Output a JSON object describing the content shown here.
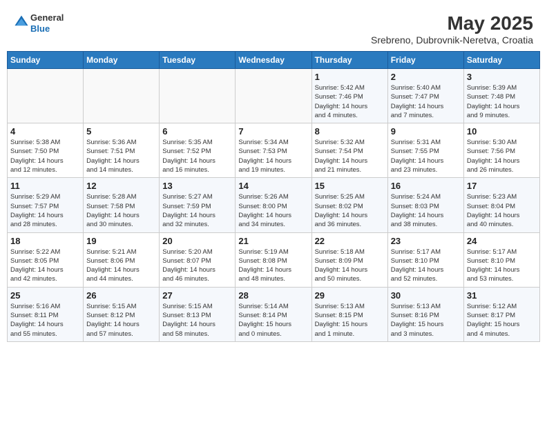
{
  "header": {
    "logo_general": "General",
    "logo_blue": "Blue",
    "month_year": "May 2025",
    "location": "Srebreno, Dubrovnik-Neretva, Croatia"
  },
  "days_of_week": [
    "Sunday",
    "Monday",
    "Tuesday",
    "Wednesday",
    "Thursday",
    "Friday",
    "Saturday"
  ],
  "weeks": [
    [
      {
        "day": "",
        "info": ""
      },
      {
        "day": "",
        "info": ""
      },
      {
        "day": "",
        "info": ""
      },
      {
        "day": "",
        "info": ""
      },
      {
        "day": "1",
        "info": "Sunrise: 5:42 AM\nSunset: 7:46 PM\nDaylight: 14 hours\nand 4 minutes."
      },
      {
        "day": "2",
        "info": "Sunrise: 5:40 AM\nSunset: 7:47 PM\nDaylight: 14 hours\nand 7 minutes."
      },
      {
        "day": "3",
        "info": "Sunrise: 5:39 AM\nSunset: 7:48 PM\nDaylight: 14 hours\nand 9 minutes."
      }
    ],
    [
      {
        "day": "4",
        "info": "Sunrise: 5:38 AM\nSunset: 7:50 PM\nDaylight: 14 hours\nand 12 minutes."
      },
      {
        "day": "5",
        "info": "Sunrise: 5:36 AM\nSunset: 7:51 PM\nDaylight: 14 hours\nand 14 minutes."
      },
      {
        "day": "6",
        "info": "Sunrise: 5:35 AM\nSunset: 7:52 PM\nDaylight: 14 hours\nand 16 minutes."
      },
      {
        "day": "7",
        "info": "Sunrise: 5:34 AM\nSunset: 7:53 PM\nDaylight: 14 hours\nand 19 minutes."
      },
      {
        "day": "8",
        "info": "Sunrise: 5:32 AM\nSunset: 7:54 PM\nDaylight: 14 hours\nand 21 minutes."
      },
      {
        "day": "9",
        "info": "Sunrise: 5:31 AM\nSunset: 7:55 PM\nDaylight: 14 hours\nand 23 minutes."
      },
      {
        "day": "10",
        "info": "Sunrise: 5:30 AM\nSunset: 7:56 PM\nDaylight: 14 hours\nand 26 minutes."
      }
    ],
    [
      {
        "day": "11",
        "info": "Sunrise: 5:29 AM\nSunset: 7:57 PM\nDaylight: 14 hours\nand 28 minutes."
      },
      {
        "day": "12",
        "info": "Sunrise: 5:28 AM\nSunset: 7:58 PM\nDaylight: 14 hours\nand 30 minutes."
      },
      {
        "day": "13",
        "info": "Sunrise: 5:27 AM\nSunset: 7:59 PM\nDaylight: 14 hours\nand 32 minutes."
      },
      {
        "day": "14",
        "info": "Sunrise: 5:26 AM\nSunset: 8:00 PM\nDaylight: 14 hours\nand 34 minutes."
      },
      {
        "day": "15",
        "info": "Sunrise: 5:25 AM\nSunset: 8:02 PM\nDaylight: 14 hours\nand 36 minutes."
      },
      {
        "day": "16",
        "info": "Sunrise: 5:24 AM\nSunset: 8:03 PM\nDaylight: 14 hours\nand 38 minutes."
      },
      {
        "day": "17",
        "info": "Sunrise: 5:23 AM\nSunset: 8:04 PM\nDaylight: 14 hours\nand 40 minutes."
      }
    ],
    [
      {
        "day": "18",
        "info": "Sunrise: 5:22 AM\nSunset: 8:05 PM\nDaylight: 14 hours\nand 42 minutes."
      },
      {
        "day": "19",
        "info": "Sunrise: 5:21 AM\nSunset: 8:06 PM\nDaylight: 14 hours\nand 44 minutes."
      },
      {
        "day": "20",
        "info": "Sunrise: 5:20 AM\nSunset: 8:07 PM\nDaylight: 14 hours\nand 46 minutes."
      },
      {
        "day": "21",
        "info": "Sunrise: 5:19 AM\nSunset: 8:08 PM\nDaylight: 14 hours\nand 48 minutes."
      },
      {
        "day": "22",
        "info": "Sunrise: 5:18 AM\nSunset: 8:09 PM\nDaylight: 14 hours\nand 50 minutes."
      },
      {
        "day": "23",
        "info": "Sunrise: 5:17 AM\nSunset: 8:10 PM\nDaylight: 14 hours\nand 52 minutes."
      },
      {
        "day": "24",
        "info": "Sunrise: 5:17 AM\nSunset: 8:10 PM\nDaylight: 14 hours\nand 53 minutes."
      }
    ],
    [
      {
        "day": "25",
        "info": "Sunrise: 5:16 AM\nSunset: 8:11 PM\nDaylight: 14 hours\nand 55 minutes."
      },
      {
        "day": "26",
        "info": "Sunrise: 5:15 AM\nSunset: 8:12 PM\nDaylight: 14 hours\nand 57 minutes."
      },
      {
        "day": "27",
        "info": "Sunrise: 5:15 AM\nSunset: 8:13 PM\nDaylight: 14 hours\nand 58 minutes."
      },
      {
        "day": "28",
        "info": "Sunrise: 5:14 AM\nSunset: 8:14 PM\nDaylight: 15 hours\nand 0 minutes."
      },
      {
        "day": "29",
        "info": "Sunrise: 5:13 AM\nSunset: 8:15 PM\nDaylight: 15 hours\nand 1 minute."
      },
      {
        "day": "30",
        "info": "Sunrise: 5:13 AM\nSunset: 8:16 PM\nDaylight: 15 hours\nand 3 minutes."
      },
      {
        "day": "31",
        "info": "Sunrise: 5:12 AM\nSunset: 8:17 PM\nDaylight: 15 hours\nand 4 minutes."
      }
    ]
  ]
}
